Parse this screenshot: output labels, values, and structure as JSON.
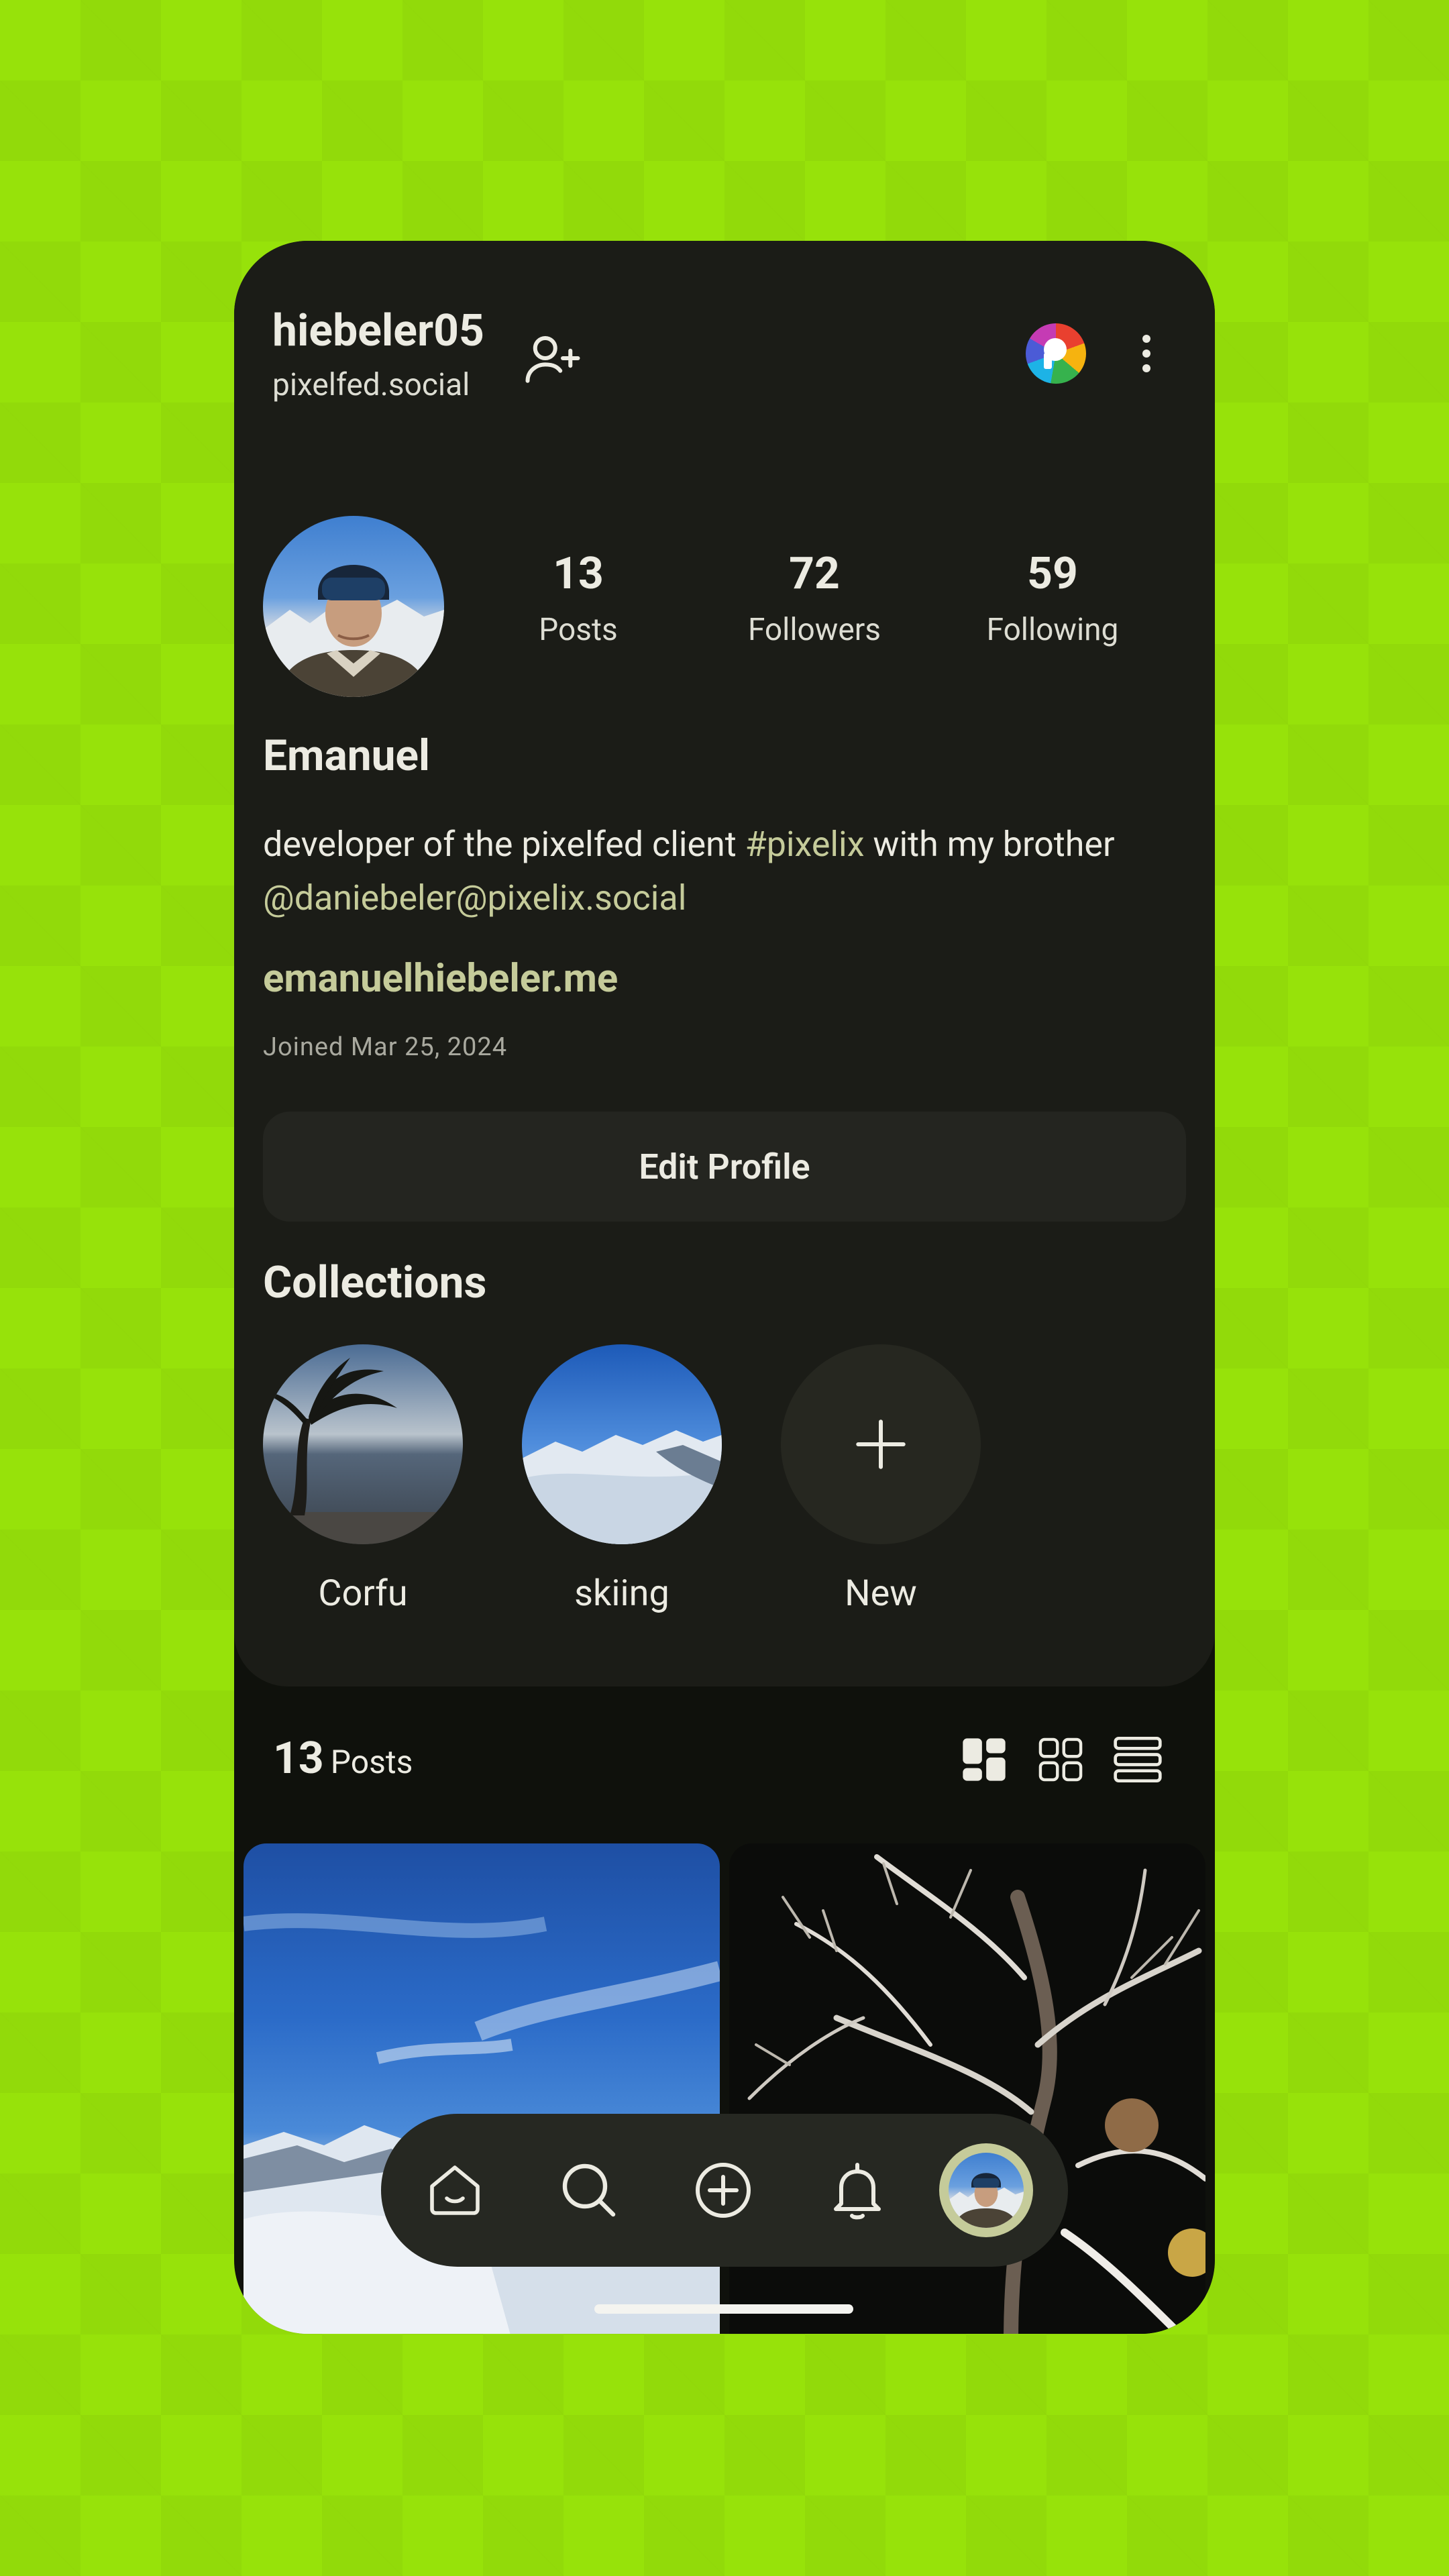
{
  "header": {
    "username": "hiebeler05",
    "domain": "pixelfed.social",
    "follow_icon": "person-add-icon",
    "app_icon": "pixelfed-logo-icon",
    "menu_icon": "more-vertical-icon"
  },
  "profile": {
    "display_name": "Emanuel",
    "bio_prefix": "developer of the pixelfed client ",
    "bio_hashtag": "#pixelix",
    "bio_middle": " with my brother",
    "bio_mention": "@daniebeler@pixelix.social",
    "website": "emanuelhiebeler.me",
    "joined": "Joined Mar 25, 2024"
  },
  "stats": [
    {
      "value": "13",
      "label": "Posts"
    },
    {
      "value": "72",
      "label": "Followers"
    },
    {
      "value": "59",
      "label": "Following"
    }
  ],
  "edit_profile_label": "Edit Profile",
  "collections": {
    "title": "Collections",
    "items": [
      {
        "label": "Corfu"
      },
      {
        "label": "skiing"
      },
      {
        "label": "New"
      }
    ]
  },
  "posts_section": {
    "count": "13",
    "word": "Posts",
    "view_modes": [
      "masonry-grid-icon",
      "grid-icon",
      "list-icon"
    ]
  },
  "bottom_nav": [
    "home-icon",
    "search-icon",
    "add-circle-icon",
    "bell-icon",
    "profile-avatar"
  ],
  "colors": {
    "background": "#97e20a",
    "surface": "#1b1c17",
    "accent": "#c5cb9a"
  }
}
